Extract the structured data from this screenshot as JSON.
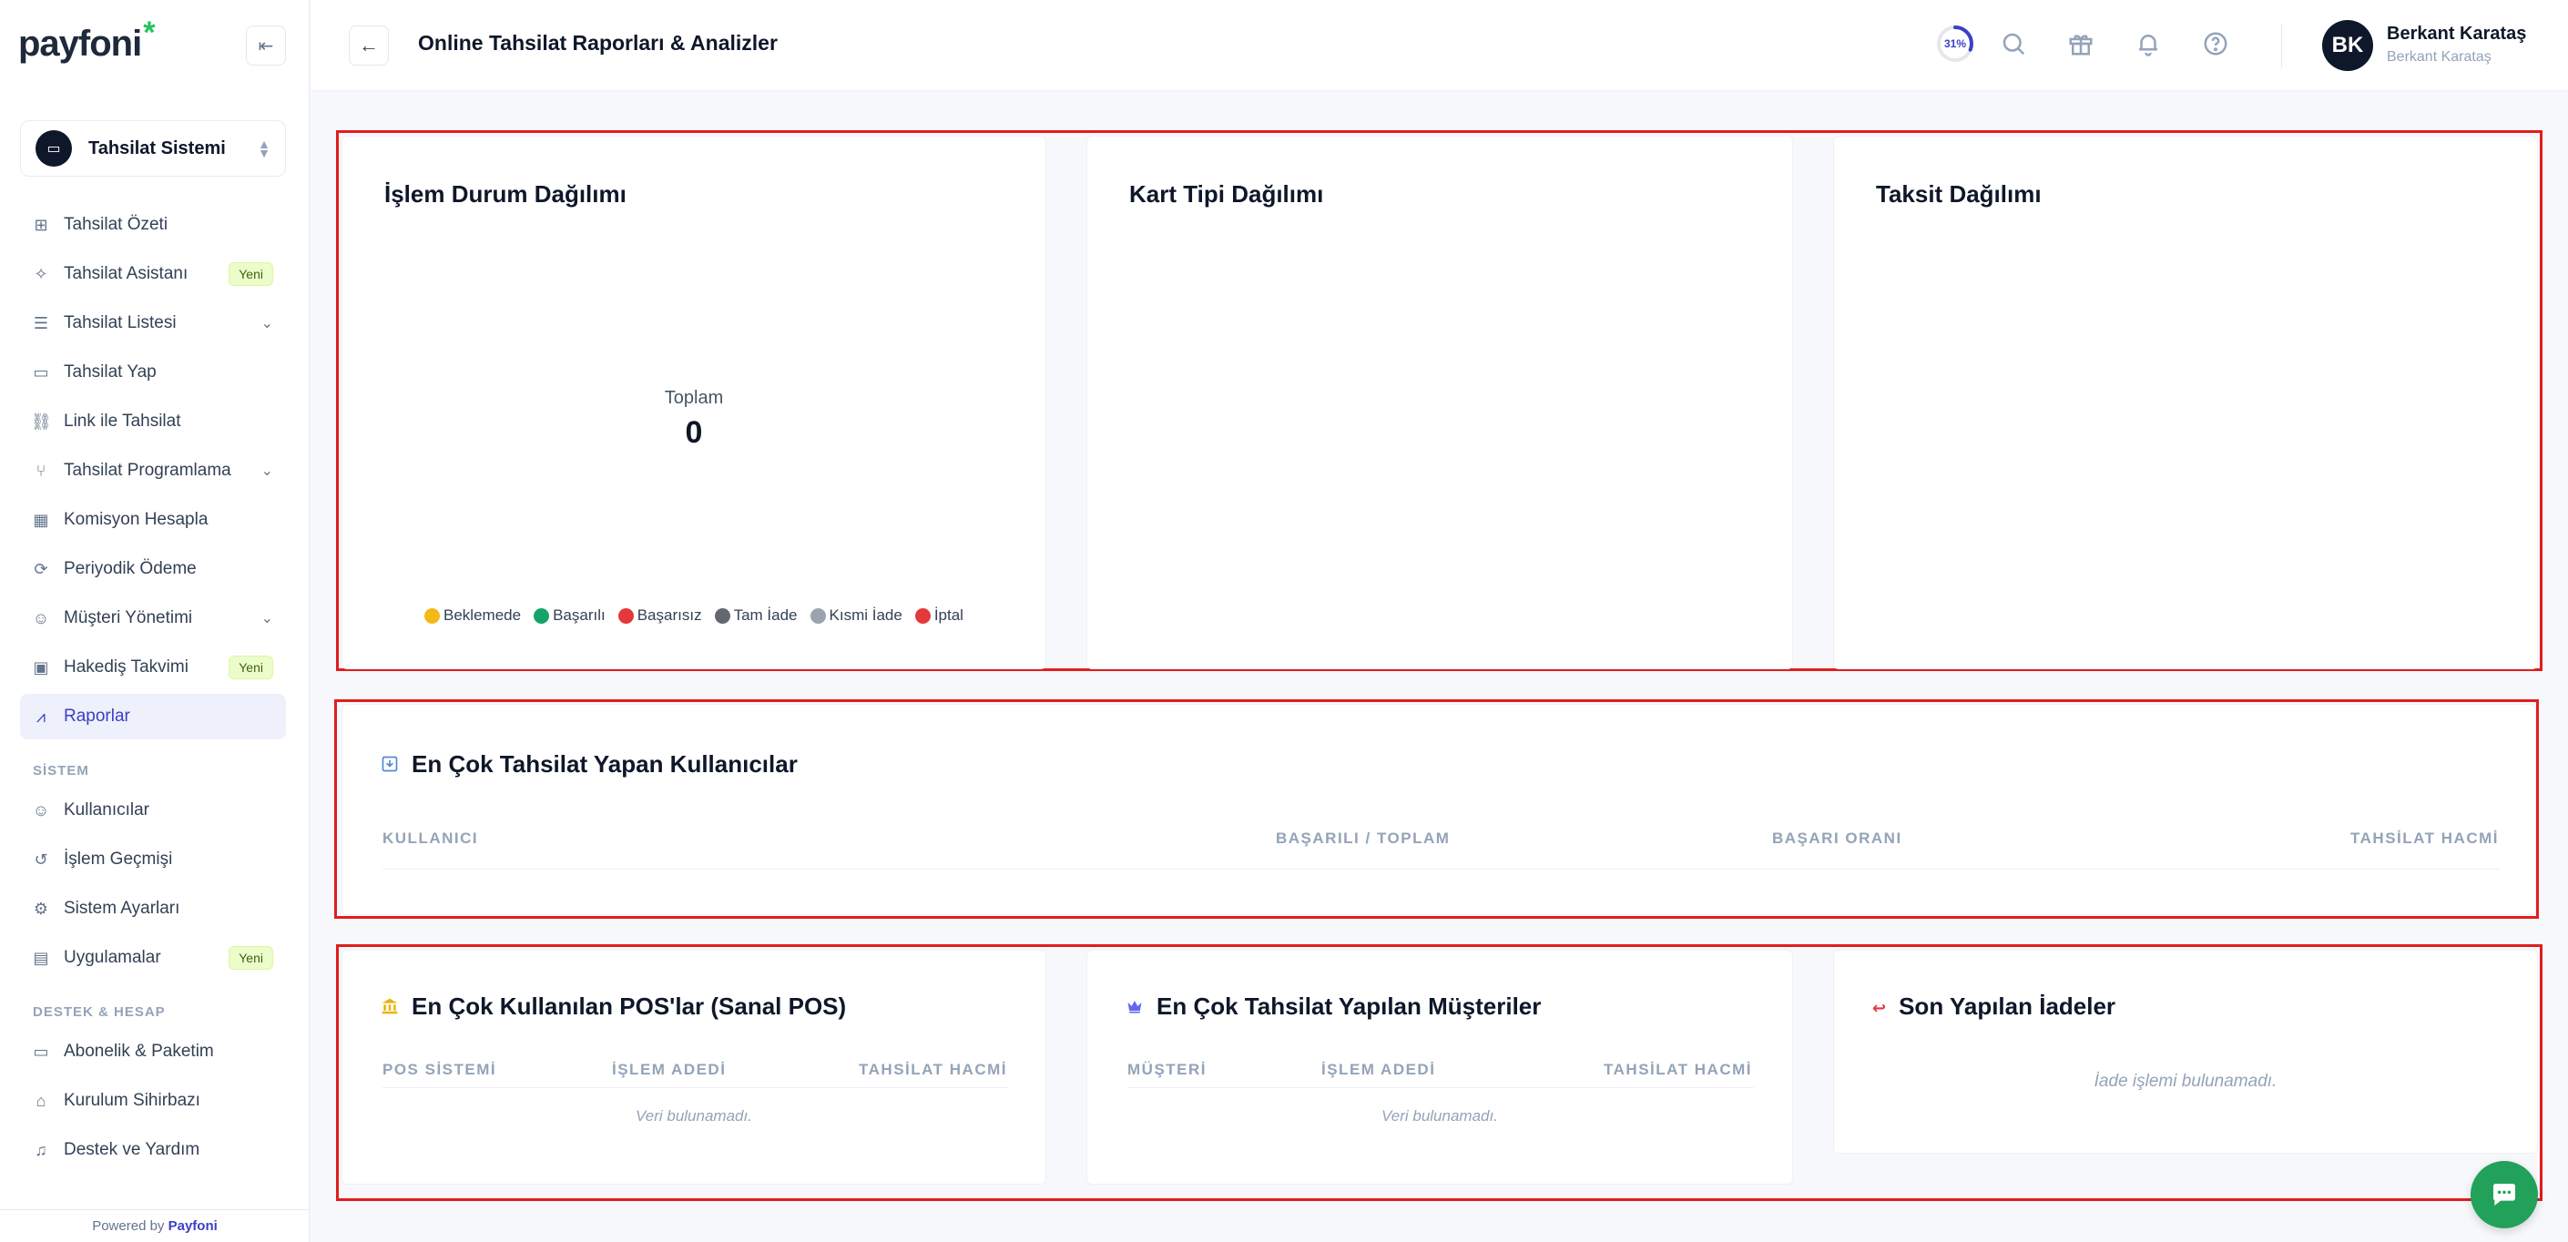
{
  "brand": {
    "name": "payfoni",
    "star": "*"
  },
  "sidebar": {
    "workspace": "Tahsilat Sistemi",
    "items": [
      {
        "label": "Tahsilat Özeti",
        "icon": "grid-icon",
        "glyph": "⊞"
      },
      {
        "label": "Tahsilat Asistanı",
        "icon": "sparkle-icon",
        "glyph": "✧",
        "badge": "Yeni"
      },
      {
        "label": "Tahsilat Listesi",
        "icon": "list-icon",
        "glyph": "☰",
        "chevron": true
      },
      {
        "label": "Tahsilat Yap",
        "icon": "card-icon",
        "glyph": "▭"
      },
      {
        "label": "Link ile Tahsilat",
        "icon": "link-icon",
        "glyph": "⛓"
      },
      {
        "label": "Tahsilat Programlama",
        "icon": "branch-icon",
        "glyph": "⑂",
        "chevron": true
      },
      {
        "label": "Komisyon Hesapla",
        "icon": "calculator-icon",
        "glyph": "▦"
      },
      {
        "label": "Periyodik Ödeme",
        "icon": "refresh-icon",
        "glyph": "⟳"
      },
      {
        "label": "Müşteri Yönetimi",
        "icon": "users-icon",
        "glyph": "☺",
        "chevron": true
      },
      {
        "label": "Hakediş Takvimi",
        "icon": "calendar-icon",
        "glyph": "▣",
        "badge": "Yeni"
      },
      {
        "label": "Raporlar",
        "icon": "chart-icon",
        "glyph": "⩘",
        "active": true
      }
    ],
    "section_system": "SİSTEM",
    "system_items": [
      {
        "label": "Kullanıcılar",
        "icon": "user-icon",
        "glyph": "☺"
      },
      {
        "label": "İşlem Geçmişi",
        "icon": "history-icon",
        "glyph": "↺"
      },
      {
        "label": "Sistem Ayarları",
        "icon": "gear-icon",
        "glyph": "⚙"
      },
      {
        "label": "Uygulamalar",
        "icon": "apps-icon",
        "glyph": "▤",
        "badge": "Yeni"
      }
    ],
    "section_support": "DESTEK & HESAP",
    "support_items": [
      {
        "label": "Abonelik & Paketim",
        "icon": "credit-card-icon",
        "glyph": "▭"
      },
      {
        "label": "Kurulum Sihirbazı",
        "icon": "rocket-icon",
        "glyph": "⌂"
      },
      {
        "label": "Destek ve Yardım",
        "icon": "headset-icon",
        "glyph": "♫"
      }
    ],
    "powered_prefix": "Powered by",
    "powered_brand": "Payfoni"
  },
  "header": {
    "title": "Online Tahsilat Raporları & Analizler",
    "progress": "31%",
    "progress_value": 0.31,
    "user_name": "Berkant Karataş",
    "user_sub": "Berkant Karataş",
    "initials": "BK"
  },
  "cards": {
    "status_title": "İşlem Durum Dağılımı",
    "total_label": "Toplam",
    "total_value": "0",
    "legend": [
      {
        "label": "Beklemede",
        "color": "#f5b819"
      },
      {
        "label": "Başarılı",
        "color": "#16a36a"
      },
      {
        "label": "Başarısız",
        "color": "#e5383b"
      },
      {
        "label": "Tam İade",
        "color": "#64676e"
      },
      {
        "label": "Kısmi İade",
        "color": "#9ca3af"
      },
      {
        "label": "İptal",
        "color": "#e5383b"
      }
    ],
    "card_type_title": "Kart Tipi Dağılımı",
    "installment_title": "Taksit Dağılımı"
  },
  "top_users": {
    "title": "En Çok Tahsilat Yapan Kullanıcılar",
    "columns": [
      "KULLANICI",
      "BAŞARILI / TOPLAM",
      "BAŞARI ORANI",
      "TAHSİLAT HACMİ"
    ]
  },
  "pos": {
    "title": "En Çok Kullanılan POS'lar (Sanal POS)",
    "columns": [
      "POS SİSTEMİ",
      "İŞLEM ADEDİ",
      "TAHSİLAT HACMİ"
    ],
    "empty": "Veri bulunamadı."
  },
  "customers": {
    "title": "En Çok Tahsilat Yapılan Müşteriler",
    "columns": [
      "MÜŞTERİ",
      "İŞLEM ADEDİ",
      "TAHSİLAT HACMİ"
    ],
    "empty": "Veri bulunamadı."
  },
  "refunds": {
    "title": "Son Yapılan İadeler",
    "empty": "İade işlemi bulunamadı."
  }
}
